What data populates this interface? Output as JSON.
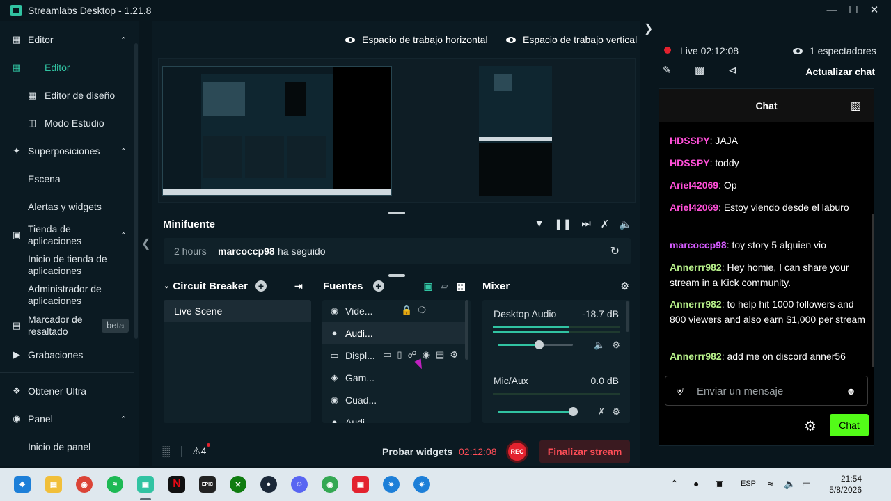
{
  "window": {
    "title": "Streamlabs Desktop - 1.21.8"
  },
  "sidebar": {
    "editor": "Editor",
    "editor_items": [
      "Editor",
      "Editor de diseño",
      "Modo Estudio"
    ],
    "overlays": "Superposiciones",
    "overlays_items": [
      "Escena",
      "Alertas y widgets"
    ],
    "app_store": "Tienda de aplicaciones",
    "app_store_items": [
      "Inicio de tienda de aplicaciones",
      "Administrador de aplicaciones"
    ],
    "highlighter": "Marcador de resaltado",
    "beta": "beta",
    "recordings": "Grabaciones",
    "ultra": "Obtener Ultra",
    "dashboard": "Panel",
    "dashboard_items": [
      "Inicio de panel"
    ]
  },
  "workspace": {
    "horizontal": "Espacio de trabajo horizontal",
    "vertical": "Espacio de trabajo vertical"
  },
  "minifeed": {
    "title": "Minifuente",
    "time": "2 hours",
    "user": "marcoccp98",
    "action": "ha seguido"
  },
  "scenes": {
    "title": "Circuit Breaker",
    "items": [
      "Live Scene"
    ]
  },
  "sources": {
    "title": "Fuentes",
    "items": [
      "Vide...",
      "Audi...",
      "Displ...",
      "Gam...",
      "Cuad...",
      "Audi..."
    ]
  },
  "mixer": {
    "title": "Mixer",
    "channels": [
      {
        "name": "Desktop Audio",
        "db": "-18.7 dB",
        "level": 0.6,
        "volume": 0.55
      },
      {
        "name": "Mic/Aux",
        "db": "0.0 dB",
        "level": 0.0,
        "volume": 1.0
      }
    ]
  },
  "footer": {
    "alerts": "4",
    "test_widgets": "Probar widgets",
    "stream_time": "02:12:08",
    "rec": "REC",
    "end_stream": "Finalizar stream"
  },
  "stream_info": {
    "live": "Live",
    "live_time": "02:12:08",
    "viewers": "1 espectadores",
    "refresh_chat": "Actualizar chat"
  },
  "chat": {
    "title": "Chat",
    "messages": [
      {
        "user": "HDSSPY",
        "text": "JAJA",
        "color": "#ff4fd8"
      },
      {
        "user": "HDSSPY",
        "text": "toddy",
        "color": "#ff4fd8"
      },
      {
        "user": "Ariel42069",
        "text": "Op",
        "color": "#ff4fd8"
      },
      {
        "user": "Ariel42069",
        "text": "Estoy viendo desde el laburo",
        "color": "#ff4fd8"
      },
      {
        "user": "marcoccp98",
        "text": "toy story 5 alguien vio",
        "color": "#d65cff"
      },
      {
        "user": "Annerrr982",
        "text": "Hey homie, I can share your stream in a Kick community.",
        "color": "#b7f08a"
      },
      {
        "user": "Annerrr982",
        "text": "to help hit 1000 followers and 800 viewers and also earn $1,000 per stream",
        "color": "#b7f08a"
      },
      {
        "user": "Annerrr982",
        "text": "add me on discord anner56",
        "color": "#b7f08a"
      }
    ],
    "placeholder": "Enviar un mensaje",
    "send": "Chat"
  },
  "taskbar": {
    "lang": "ESP",
    "time": "21:54",
    "date": "5/8/2026"
  },
  "colors": {
    "accent": "#31c3a2",
    "live": "#e3222e",
    "kick_green": "#53fc18"
  }
}
